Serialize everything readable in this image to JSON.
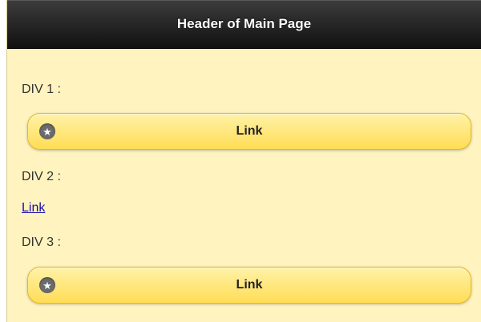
{
  "header": {
    "title": "Header of Main Page"
  },
  "sections": [
    {
      "label": "DIV 1 :",
      "button_label": "Link",
      "icon": "star-icon"
    },
    {
      "label": "DIV 2 :",
      "link_label": "Link"
    },
    {
      "label": "DIV 3 :",
      "button_label": "Link",
      "icon": "star-icon"
    }
  ],
  "colors": {
    "header_bg": "#1a1a1a",
    "page_bg": "#fff3bf",
    "button_bg": "#ffdd55",
    "link": "#1a0dab"
  }
}
